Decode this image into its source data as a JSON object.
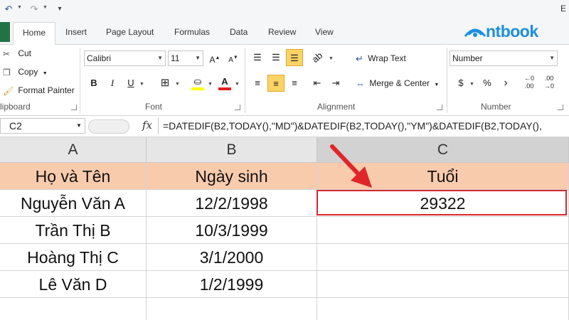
{
  "quick_access": {
    "icons": [
      "undo-icon",
      "redo-icon",
      "customize-qat-icon"
    ]
  },
  "title_fragment": "E",
  "ribbon_tabs": [
    {
      "label": "Home",
      "active": true
    },
    {
      "label": "Insert"
    },
    {
      "label": "Page Layout"
    },
    {
      "label": "Formulas"
    },
    {
      "label": "Data"
    },
    {
      "label": "Review"
    },
    {
      "label": "View"
    }
  ],
  "brand": {
    "text": "ntbook",
    "color": "#1a8fe0"
  },
  "clipboard": {
    "cut": "Cut",
    "copy": "Copy",
    "format_painter": "Format Painter",
    "group_label": "lipboard"
  },
  "font": {
    "family": "Calibri",
    "size": "11",
    "group_label": "Font",
    "fill_color": "#ffff00",
    "font_color": "#e02020"
  },
  "alignment": {
    "wrap_text": "Wrap Text",
    "merge_center": "Merge & Center",
    "group_label": "Alignment"
  },
  "number": {
    "format": "Number",
    "group_label": "Number"
  },
  "formula_bar": {
    "cell_ref": "C2",
    "fx": "fx",
    "formula": "=DATEDIF(B2,TODAY(),\"MD\")&DATEDIF(B2,TODAY(),\"YM\")&DATEDIF(B2,TODAY(),"
  },
  "sheet": {
    "columns": [
      "A",
      "B",
      "C"
    ],
    "header_row": [
      "Họ và Tên",
      "Ngày sinh",
      "Tuổi"
    ],
    "rows": [
      [
        "Nguyễn Văn A",
        "12/2/1998",
        "29322"
      ],
      [
        "Trần Thị B",
        "10/3/1999",
        ""
      ],
      [
        "Hoàng Thị C",
        "3/1/2000",
        ""
      ],
      [
        "Lê Văn D",
        "1/2/1999",
        ""
      ]
    ],
    "selected_cell": "C2",
    "header_fill": "#f8cbad",
    "highlight_color": "#d9272e"
  }
}
